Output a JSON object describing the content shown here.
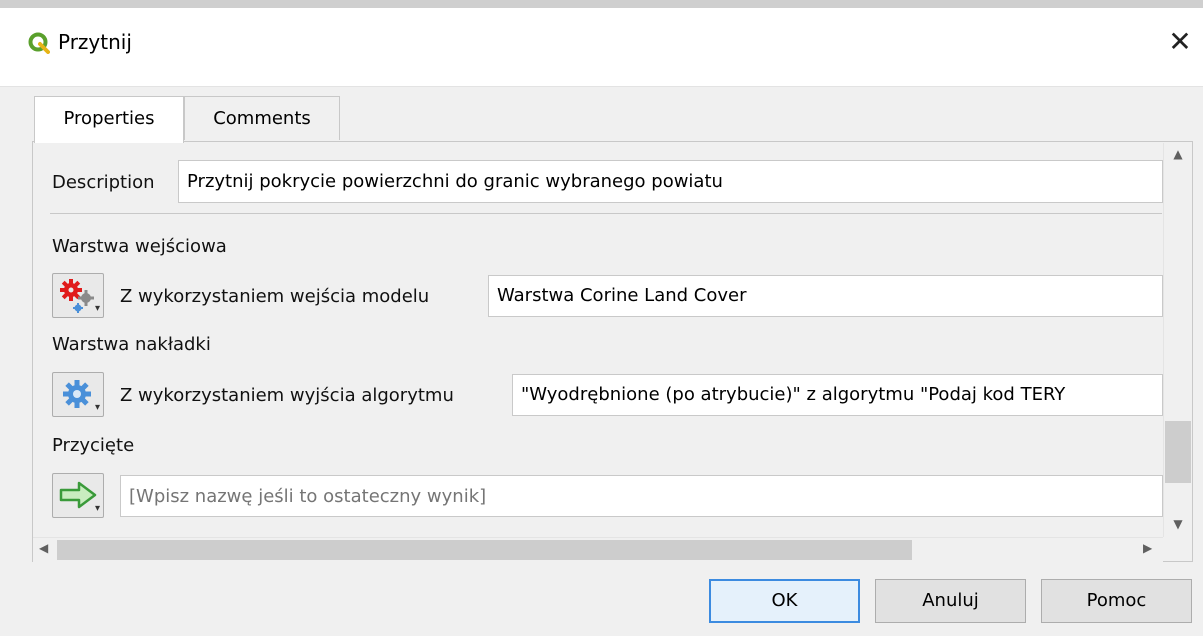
{
  "window": {
    "title": "Przytnij",
    "close_glyph": "✕",
    "app_icon": "qgis-icon"
  },
  "tabs": [
    {
      "label": "Properties",
      "active": true
    },
    {
      "label": "Comments",
      "active": false
    }
  ],
  "form": {
    "description_label": "Description",
    "description_value": "Przytnij pokrycie powierzchni do granic wybranego powiatu",
    "input_layer": {
      "label": "Warstwa wejściowa",
      "source_icon": "model-input-gear-icon",
      "source_label": "Z wykorzystaniem wejścia modelu",
      "value": "Warstwa Corine Land Cover"
    },
    "overlay_layer": {
      "label": "Warstwa nakładki",
      "source_icon": "algorithm-output-gear-icon",
      "source_label": "Z wykorzystaniem wyjścia algorytmu",
      "value": "\"Wyodrębnione (po atrybucie)\" z algorytmu \"Podaj kod TERY"
    },
    "clipped": {
      "label": "Przycięte",
      "source_icon": "output-arrow-icon",
      "placeholder": "[Wpisz nazwę jeśli to ostateczny wynik]"
    }
  },
  "buttons": {
    "ok": "OK",
    "cancel": "Anuluj",
    "help": "Pomoc"
  },
  "colors": {
    "accent": "#3c8be0",
    "qgis_green": "#5aa02c",
    "gear_red": "#e01b1b",
    "gear_blue": "#4a90d9",
    "arrow_green": "#3a9a3a"
  }
}
